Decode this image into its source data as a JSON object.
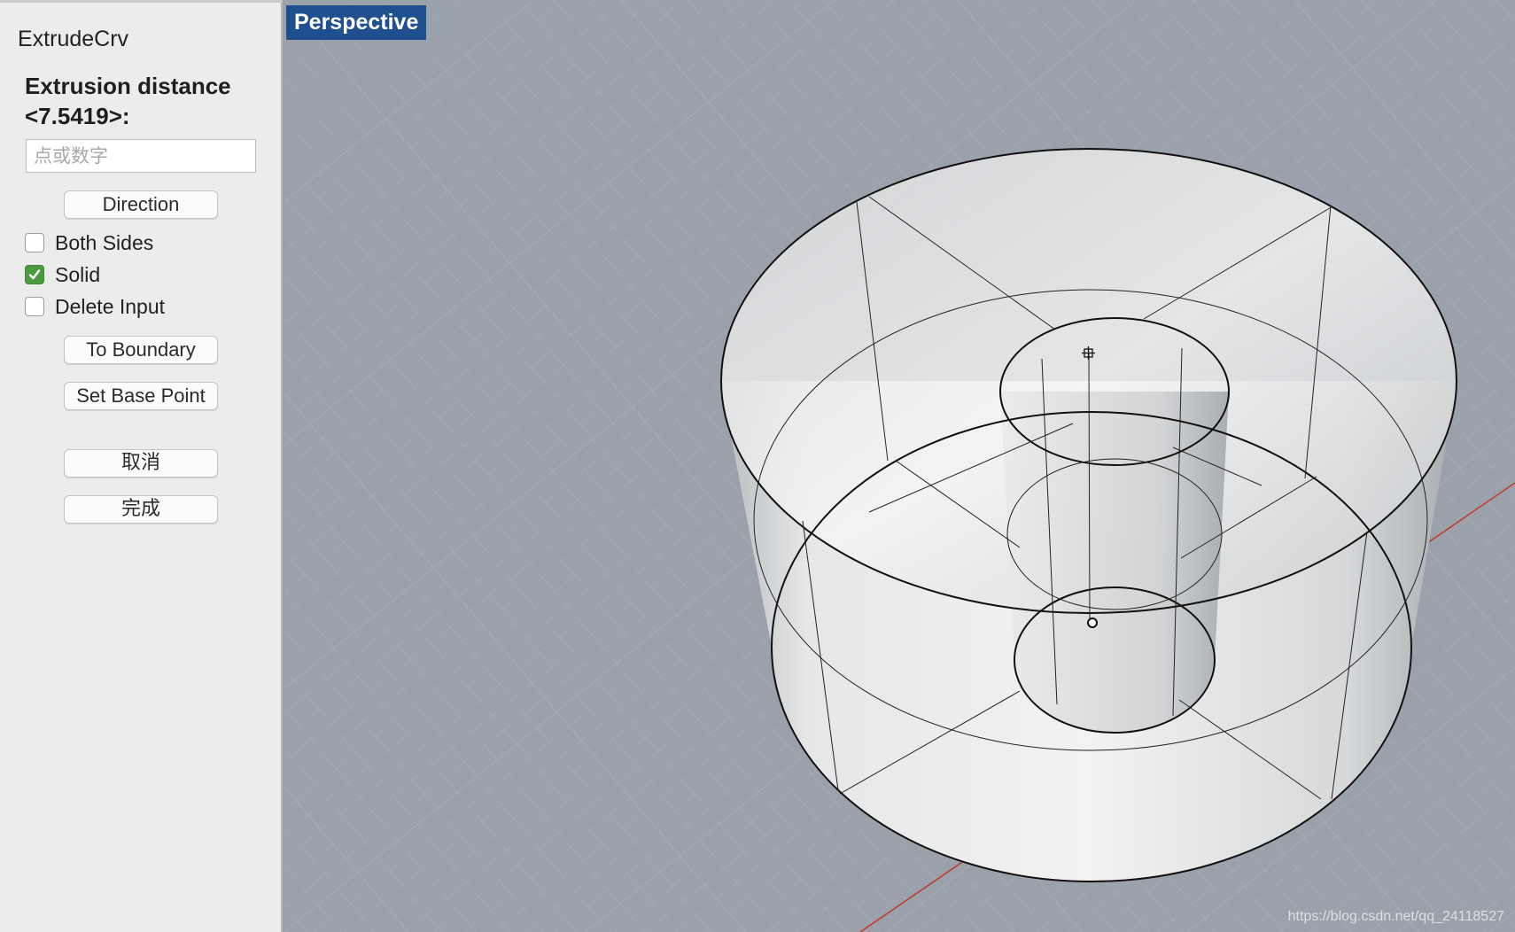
{
  "panel": {
    "command_name": "ExtrudeCrv",
    "prompt": "Extrusion distance <7.5419>:",
    "input": {
      "placeholder": "点或数字",
      "value": ""
    },
    "direction_button": "Direction",
    "options": [
      {
        "label": "Both Sides",
        "checked": false
      },
      {
        "label": "Solid",
        "checked": true
      },
      {
        "label": "Delete Input",
        "checked": false
      }
    ],
    "to_boundary_button": "To Boundary",
    "set_base_point_button": "Set Base Point",
    "cancel_button": "取消",
    "done_button": "完成"
  },
  "viewport": {
    "title": "Perspective",
    "watermark": "https://blog.csdn.net/qq_24118527"
  },
  "colors": {
    "viewport_title_bg": "#1f4f8f",
    "viewport_bg": "#9aa1aa",
    "grid_line": "#a8aeb6",
    "x_axis": "#c0392b",
    "checkbox_checked": "#4a9a3e"
  }
}
